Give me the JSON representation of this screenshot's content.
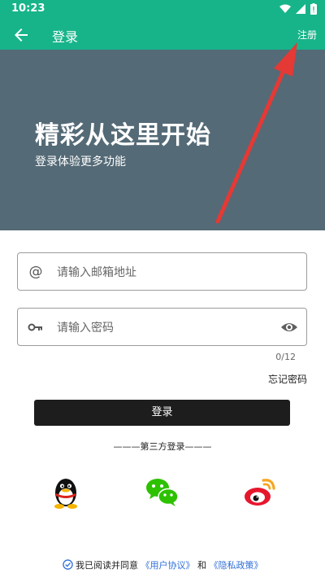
{
  "status": {
    "time": "10:23"
  },
  "appbar": {
    "title": "登录",
    "register": "注册"
  },
  "hero": {
    "headline": "精彩从这里开始",
    "subtitle": "登录体验更多功能"
  },
  "email": {
    "placeholder": "请输入邮箱地址"
  },
  "password": {
    "placeholder": "请输入密码",
    "counter": "0/12"
  },
  "forgot": "忘记密码",
  "login_button": "登录",
  "third_party": "———第三方登录———",
  "agreement": {
    "prefix": "我已阅读并同意",
    "user_agreement": "《用户协议》",
    "and": "和",
    "privacy": "《隐私政策》"
  },
  "colors": {
    "primary": "#17b48a",
    "hero": "#546a76",
    "button": "#1d1d1d",
    "link": "#2f6fd8",
    "annotation_arrow": "#e53935"
  }
}
